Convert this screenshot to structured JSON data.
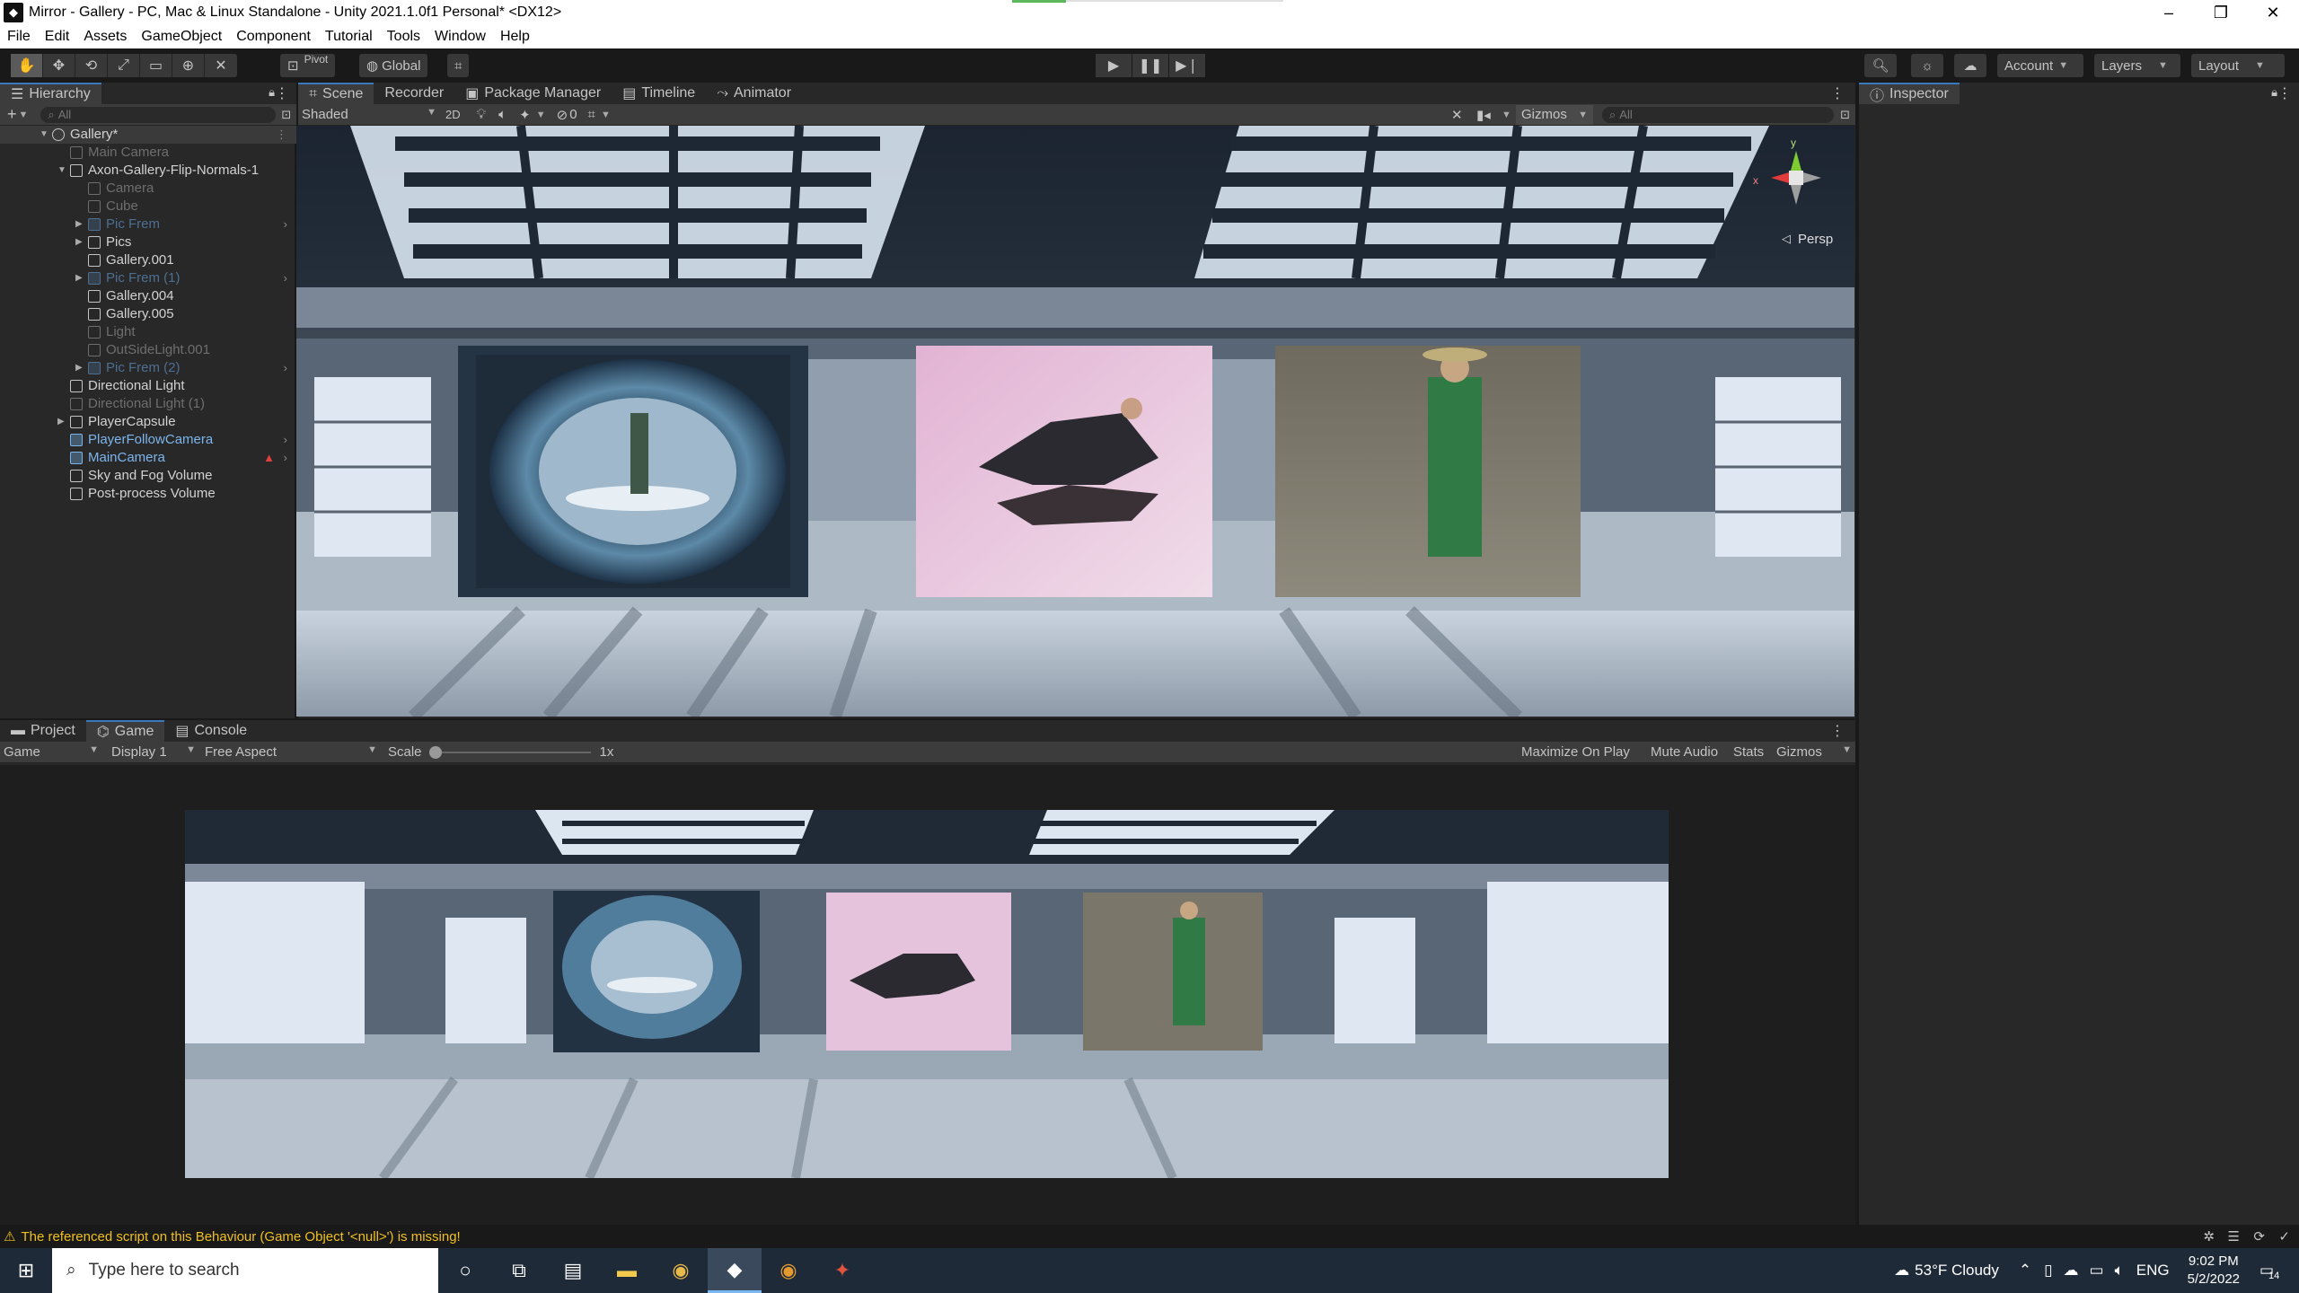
{
  "window": {
    "title": "Mirror - Gallery - PC, Mac & Linux Standalone - Unity 2021.1.0f1 Personal* <DX12>",
    "controls": [
      "–",
      "❐",
      "✕"
    ]
  },
  "menu": [
    "File",
    "Edit",
    "Assets",
    "GameObject",
    "Component",
    "Tutorial",
    "Tools",
    "Window",
    "Help"
  ],
  "toolbar": {
    "pivot_label": "Pivot",
    "global_label": "Global",
    "account_label": "Account",
    "layers_label": "Layers",
    "layout_label": "Layout"
  },
  "hierarchy": {
    "tab_label": "Hierarchy",
    "search_placeholder": "All",
    "items": [
      {
        "label": "Gallery*",
        "depth": 0,
        "style": "root",
        "expanded": true
      },
      {
        "label": "Main Camera",
        "depth": 1,
        "style": "dim"
      },
      {
        "label": "Axon-Gallery-Flip-Normals-1",
        "depth": 1,
        "style": "normal",
        "expanded": true
      },
      {
        "label": "Camera",
        "depth": 2,
        "style": "dim"
      },
      {
        "label": "Cube",
        "depth": 2,
        "style": "dim"
      },
      {
        "label": "Pic Frem",
        "depth": 2,
        "style": "prefab-dim",
        "collapsed": true,
        "arrow": true
      },
      {
        "label": "Pics",
        "depth": 2,
        "style": "normal",
        "collapsed": true
      },
      {
        "label": "Gallery.001",
        "depth": 2,
        "style": "normal"
      },
      {
        "label": "Pic Frem (1)",
        "depth": 2,
        "style": "prefab-dim",
        "collapsed": true,
        "arrow": true
      },
      {
        "label": "Gallery.004",
        "depth": 2,
        "style": "normal"
      },
      {
        "label": "Gallery.005",
        "depth": 2,
        "style": "normal"
      },
      {
        "label": "Light",
        "depth": 2,
        "style": "dim"
      },
      {
        "label": "OutSideLight.001",
        "depth": 2,
        "style": "dim"
      },
      {
        "label": "Pic Frem (2)",
        "depth": 2,
        "style": "prefab-dim",
        "collapsed": true,
        "arrow": true
      },
      {
        "label": "Directional Light",
        "depth": 1,
        "style": "normal"
      },
      {
        "label": "Directional Light (1)",
        "depth": 1,
        "style": "dim"
      },
      {
        "label": "PlayerCapsule",
        "depth": 1,
        "style": "normal",
        "collapsed": true
      },
      {
        "label": "PlayerFollowCamera",
        "depth": 1,
        "style": "prefab",
        "arrow": true
      },
      {
        "label": "MainCamera",
        "depth": 1,
        "style": "prefab",
        "arrow": true,
        "warning": true
      },
      {
        "label": "Sky and Fog Volume",
        "depth": 1,
        "style": "normal"
      },
      {
        "label": "Post-process Volume",
        "depth": 1,
        "style": "normal"
      }
    ]
  },
  "scene": {
    "tabs": [
      "Scene",
      "Recorder",
      "Package Manager",
      "Timeline",
      "Animator"
    ],
    "shading_mode": "Shaded",
    "mode_2d": "2D",
    "hidden_count": "0",
    "gizmos_label": "Gizmos",
    "search_placeholder": "All",
    "projection_label": "Persp",
    "gizmo_axes": [
      "y",
      "x"
    ]
  },
  "inspector": {
    "tab_label": "Inspector"
  },
  "bottom": {
    "tabs": [
      "Project",
      "Game",
      "Console"
    ],
    "game_dropdown": "Game",
    "display_dropdown": "Display 1",
    "aspect_dropdown": "Free Aspect",
    "scale_label": "Scale",
    "scale_value": "1x",
    "scale_fraction": 0,
    "maximize_label": "Maximize On Play",
    "mute_label": "Mute Audio",
    "stats_label": "Stats",
    "gizmos_label": "Gizmos"
  },
  "status": {
    "message": "The referenced script on this Behaviour (Game Object '<null>') is missing!"
  },
  "taskbar": {
    "search_placeholder": "Type here to search",
    "weather": "53°F  Cloudy",
    "language": "ENG",
    "time": "9:02 PM",
    "date": "5/2/2022",
    "notification_count": "14"
  },
  "colors": {
    "accent": "#3a79bb",
    "prefab": "#7cb5ec",
    "warning": "#f0c020"
  }
}
